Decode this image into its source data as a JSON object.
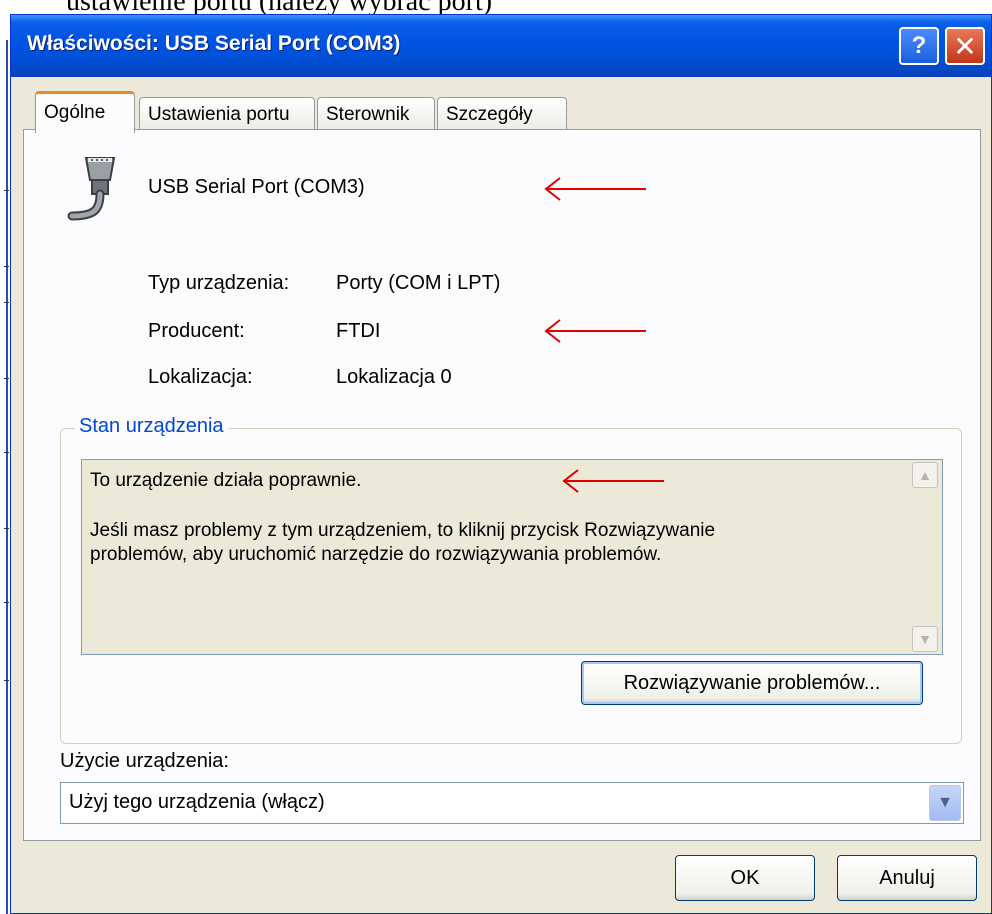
{
  "background_text": "ustawienie portu (należy wybrać port)",
  "window": {
    "title": "Właściwości: USB Serial Port (COM3)",
    "help_glyph": "?",
    "close_glyph": "✕"
  },
  "tabs": [
    {
      "label": "Ogólne",
      "active": true
    },
    {
      "label": "Ustawienia portu",
      "active": false
    },
    {
      "label": "Sterownik",
      "active": false
    },
    {
      "label": "Szczegóły",
      "active": false
    }
  ],
  "device": {
    "name": "USB Serial Port (COM3)",
    "icon": "serial-port-icon",
    "type_label": "Typ urządzenia:",
    "type_value": "Porty (COM i LPT)",
    "manufacturer_label": "Producent:",
    "manufacturer_value": "FTDI",
    "location_label": "Lokalizacja:",
    "location_value": "Lokalizacja 0"
  },
  "status": {
    "group_title": "Stan urządzenia",
    "line1": "To urządzenie działa poprawnie.",
    "line2": "Jeśli masz problemy z tym urządzeniem, to kliknij przycisk Rozwiązywanie",
    "line3": "problemów, aby uruchomić narzędzie do rozwiązywania problemów.",
    "troubleshoot_button": "Rozwiązywanie problemów..."
  },
  "usage": {
    "label": "Użycie urządzenia:",
    "selected": "Użyj tego urządzenia (włącz)"
  },
  "buttons": {
    "ok": "OK",
    "cancel": "Anuluj"
  },
  "colors": {
    "annotation_arrow": "#e00000",
    "titlebar": "#0054e3",
    "dialog_bg": "#ECE9D8",
    "groupbox_title": "#0046d5"
  }
}
